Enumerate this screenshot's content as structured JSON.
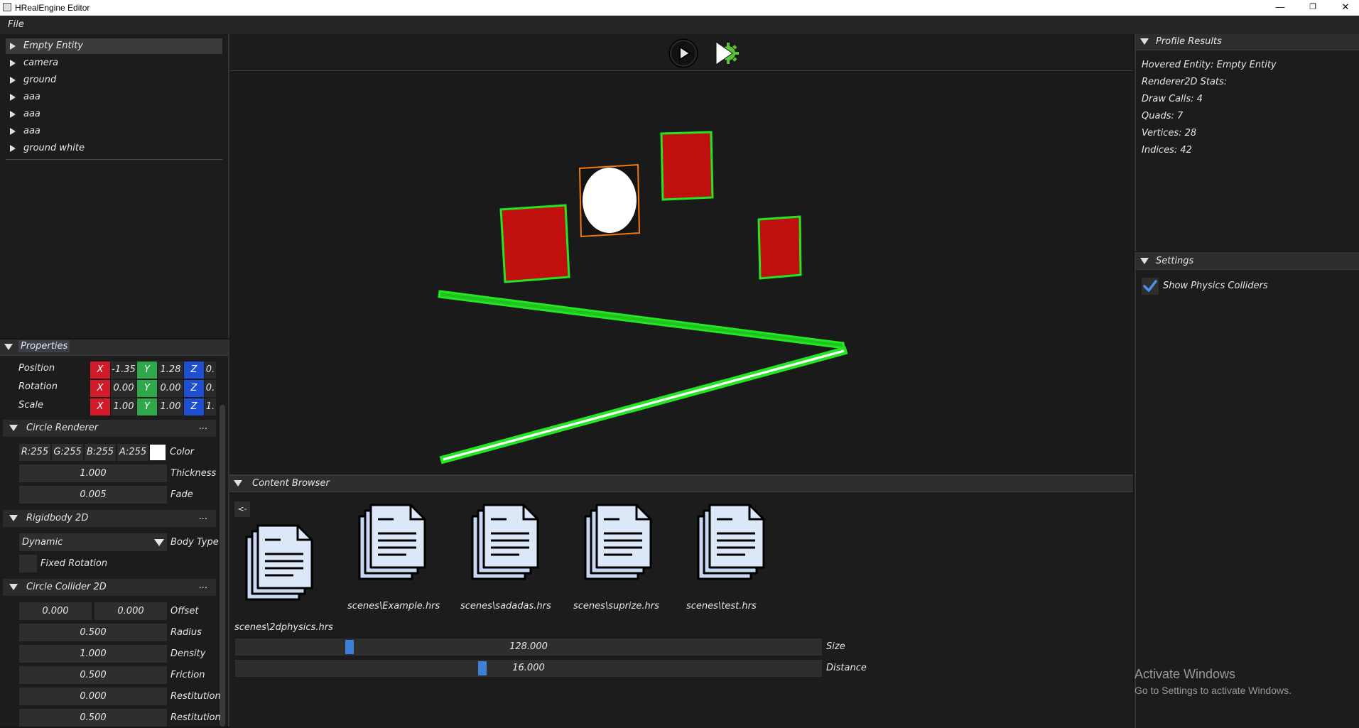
{
  "window": {
    "title": "HRealEngine Editor",
    "minimize": "—",
    "restore": "❐",
    "close": "✕"
  },
  "menu": {
    "file": "File"
  },
  "hierarchy": {
    "items": [
      "Empty Entity",
      "camera",
      "ground",
      "aaa",
      "aaa",
      "aaa",
      "ground white"
    ]
  },
  "properties": {
    "tab": "Properties",
    "transform": {
      "rows": [
        {
          "label": "Position",
          "x": "-1.35",
          "y": "1.28",
          "z": "0."
        },
        {
          "label": "Rotation",
          "x": "0.00",
          "y": "0.00",
          "z": "0."
        },
        {
          "label": "Scale",
          "x": "1.00",
          "y": "1.00",
          "z": "1."
        }
      ],
      "x_label": "X",
      "y_label": "Y",
      "z_label": "Z"
    },
    "circle_renderer": {
      "title": "Circle Renderer",
      "menu": "...",
      "r": "R:255",
      "g": "G:255",
      "b": "B:255",
      "a": "A:255",
      "color_label": "Color",
      "thickness": "1.000",
      "thickness_label": "Thickness",
      "fade": "0.005",
      "fade_label": "Fade"
    },
    "rigidbody": {
      "title": "Rigidbody 2D",
      "menu": "...",
      "body_type": "Dynamic",
      "body_type_label": "Body Type",
      "fixed_rotation_label": "Fixed Rotation"
    },
    "circle_collider": {
      "title": "Circle Collider 2D",
      "menu": "...",
      "offset_x": "0.000",
      "offset_y": "0.000",
      "offset_label": "Offset",
      "radius": "0.500",
      "radius_label": "Radius",
      "density": "1.000",
      "density_label": "Density",
      "friction": "0.500",
      "friction_label": "Friction",
      "restitution": "0.000",
      "restitution_label": "Restitution",
      "restitution_threshold": "0.500",
      "restitution_threshold_label": "Restitution"
    }
  },
  "toolbar": {
    "play_icon": "play-icon",
    "simulate_icon": "simulate-icon"
  },
  "content_browser": {
    "tab": "Content Browser",
    "back": "<-",
    "files": [
      "scenes\\2dphysics.hrs",
      "scenes\\Example.hrs",
      "scenes\\sadadas.hrs",
      "scenes\\suprize.hrs",
      "scenes\\test.hrs"
    ],
    "size_value": "128.000",
    "size_label": "Size",
    "size_fraction": 0.19,
    "distance_value": "16.000",
    "distance_label": "Distance",
    "distance_fraction": 0.42
  },
  "profile": {
    "tab": "Profile Results",
    "hovered": "Hovered Entity: Empty Entity",
    "stats_title": "Renderer2D Stats:",
    "draw_calls": "Draw Calls: 4",
    "quads": "Quads: 7",
    "vertices": "Vertices: 28",
    "indices": "Indices: 42"
  },
  "settings": {
    "tab": "Settings",
    "show_colliders": "Show Physics Colliders",
    "checked": true
  },
  "watermark": {
    "line1": "Activate Windows",
    "line2": "Go to Settings to activate Windows."
  },
  "colors": {
    "x_axis": "#d11a2a",
    "y_axis": "#2ea84a",
    "z_axis": "#1f4fd1",
    "collider": "#22e622",
    "selection": "#f07a10",
    "quad": "#c0100e"
  }
}
